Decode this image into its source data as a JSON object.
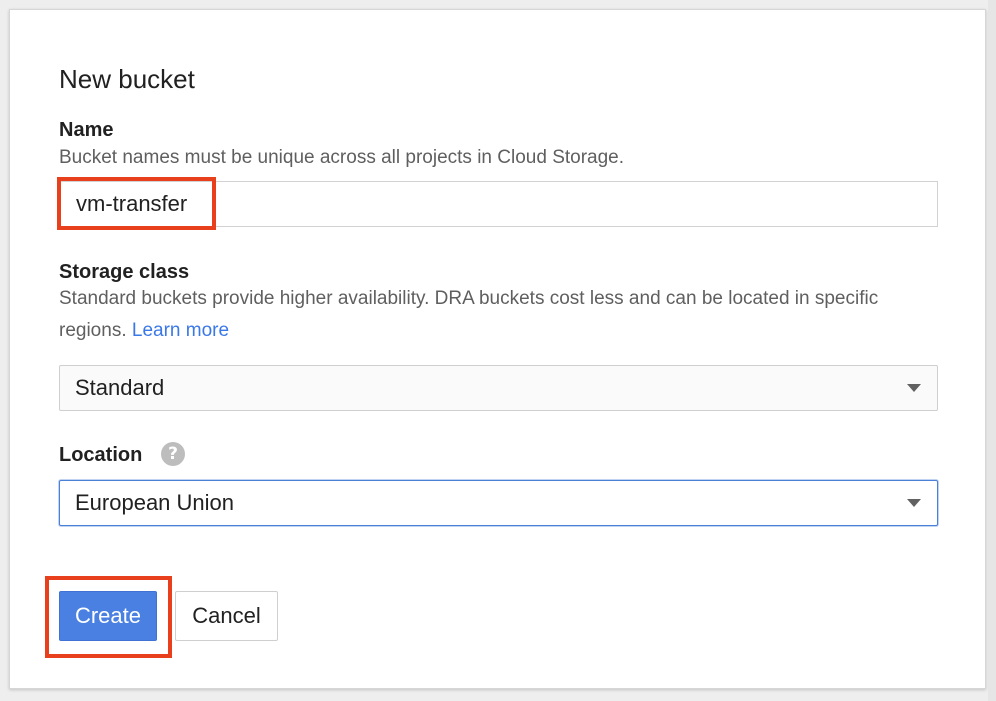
{
  "dialog": {
    "title": "New bucket"
  },
  "name_field": {
    "label": "Name",
    "help": "Bucket names must be unique across all projects in Cloud Storage.",
    "value": "vm-transfer"
  },
  "storage_class": {
    "label": "Storage class",
    "help": "Standard buckets provide higher availability. DRA buckets cost less and can be located in specific regions.",
    "learn_more": "Learn more",
    "selected": "Standard"
  },
  "location": {
    "label": "Location",
    "help_icon": "?",
    "selected": "European Union"
  },
  "actions": {
    "create_label": "Create",
    "cancel_label": "Cancel"
  },
  "colors": {
    "primary_button": "#4a80e2",
    "highlight": "#e8401c",
    "link": "#3b78e7",
    "focus_border": "#4a80d8"
  },
  "icons": {
    "help": "help-circle-icon",
    "dropdown": "caret-down-icon"
  }
}
